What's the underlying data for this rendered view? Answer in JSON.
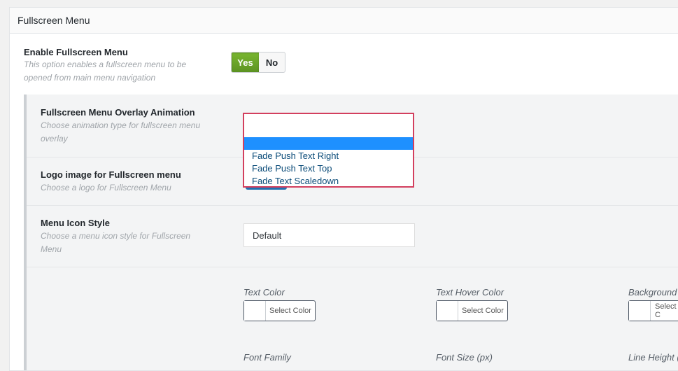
{
  "panel": {
    "title": "Fullscreen Menu"
  },
  "enable": {
    "label": "Enable Fullscreen Menu",
    "desc_line1": "This option enables a fullscreen menu to be",
    "desc_line2": "opened from main menu navigation",
    "yes_label": "Yes",
    "no_label": "No",
    "selected": "Yes",
    "accent_color": "#6ca72a"
  },
  "overlay_animation": {
    "label": "Fullscreen Menu Overlay Animation",
    "desc_line1": "Choose animation type for fullscreen menu",
    "desc_line2": "overlay",
    "current_value": "",
    "options": [
      "",
      "Fade Push Text Right",
      "Fade Push Text Top",
      "Fade Text Scaledown"
    ],
    "focus_color": "#d33f5e",
    "highlight_color": "#1e90ff"
  },
  "logo": {
    "label": "Logo image for Fullscreen menu",
    "desc": "Choose a logo for Fullscreen Menu"
  },
  "icon_style": {
    "label": "Menu Icon Style",
    "desc_line1": "Choose a menu icon style for Fullscreen",
    "desc_line2": "Menu",
    "value": "Default"
  },
  "colors": {
    "text_color_label": "Text Color",
    "text_hover_color_label": "Text Hover Color",
    "background_label": "Background I",
    "select_color": "Select Color",
    "select_color_partial": "Select C"
  },
  "typography": {
    "font_family_label": "Font Family",
    "font_size_label": "Font Size (px)",
    "line_height_label": "Line Height ("
  }
}
